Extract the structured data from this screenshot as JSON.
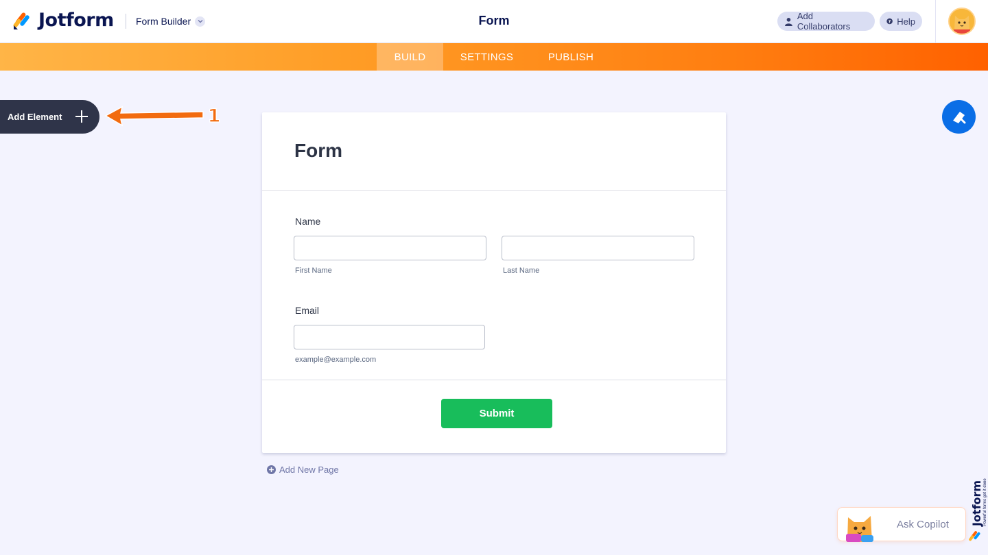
{
  "header": {
    "brand": "Jotform",
    "builder_label": "Form Builder",
    "form_title": "Form",
    "collaborators_label": "Add Collaborators",
    "help_label": "Help"
  },
  "nav": {
    "tabs": [
      {
        "label": "BUILD",
        "active": true
      },
      {
        "label": "SETTINGS",
        "active": false
      },
      {
        "label": "PUBLISH",
        "active": false
      }
    ]
  },
  "sidebar": {
    "add_element_label": "Add Element",
    "annotation_number": "1"
  },
  "form": {
    "title": "Form",
    "name_field": {
      "label": "Name",
      "first_sublabel": "First Name",
      "last_sublabel": "Last Name",
      "first_value": "",
      "last_value": ""
    },
    "email_field": {
      "label": "Email",
      "sublabel": "example@example.com",
      "value": ""
    },
    "submit_label": "Submit"
  },
  "add_new_page_label": "Add New Page",
  "copilot": {
    "label": "Ask Copilot"
  },
  "side_brand": {
    "name": "Jotform",
    "tagline": "Powerful forms get it done"
  },
  "colors": {
    "nav_gradient_start": "#ffb547",
    "nav_gradient_end": "#ff6100",
    "add_element_bg": "#2f3449",
    "paint_button": "#0a6ee6",
    "submit": "#18bd5b",
    "annotation_arrow": "#f26b0f"
  },
  "icons": {
    "paint": "paint-roller-icon",
    "add": "plus-icon",
    "help": "question-circle-icon",
    "collaborators": "user-icon"
  }
}
